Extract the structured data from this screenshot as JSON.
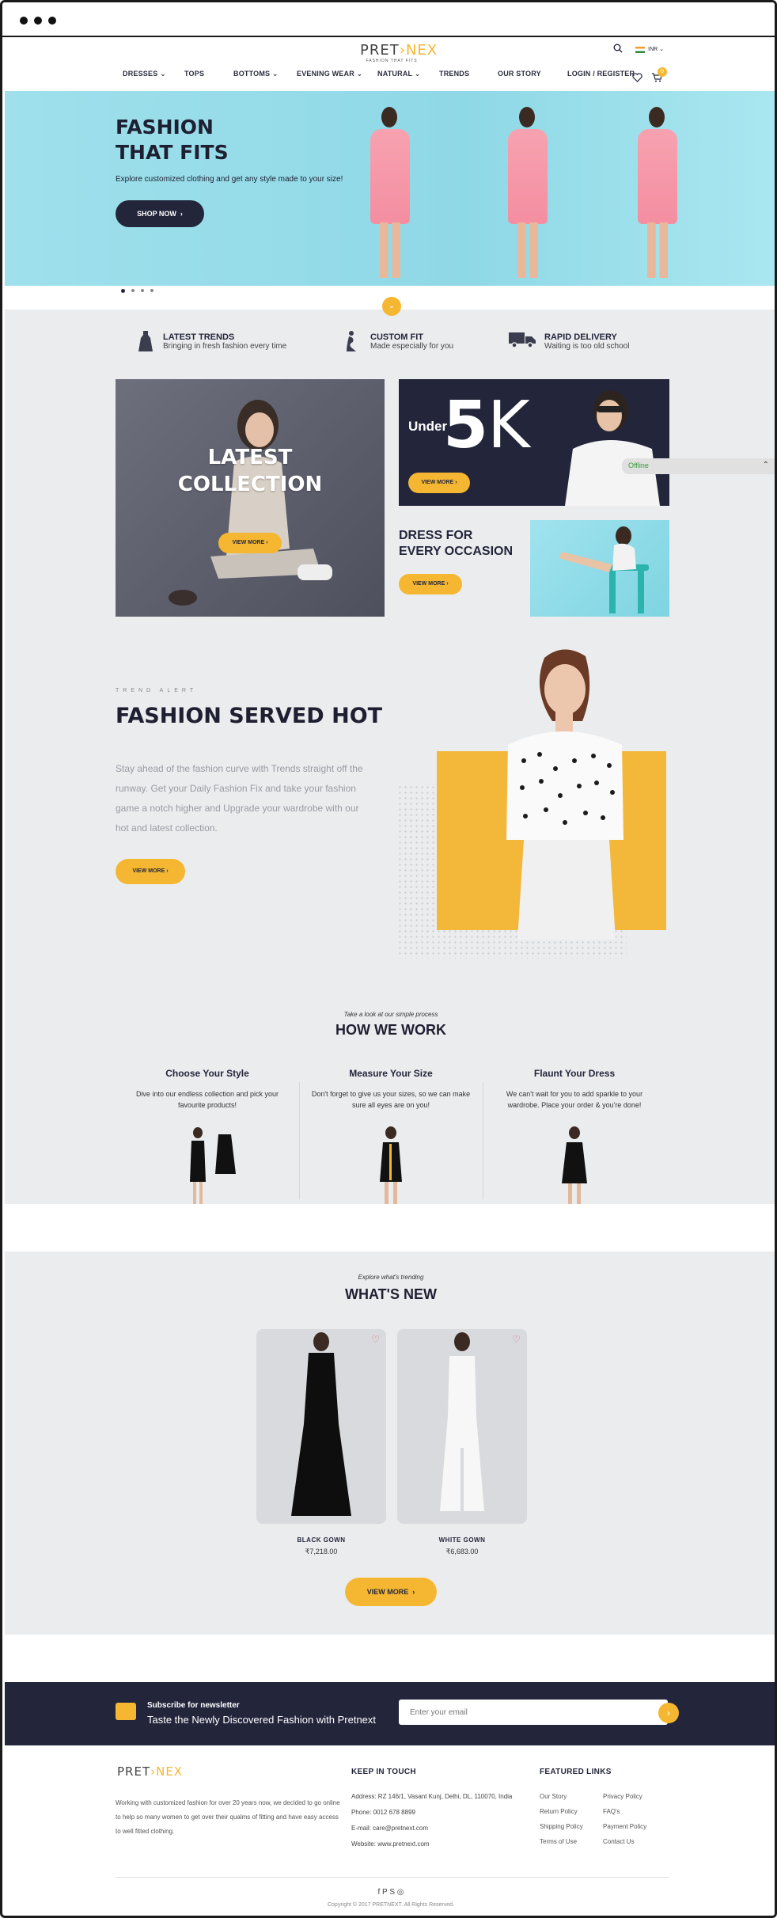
{
  "brand": {
    "name_left": "PRET",
    "name_right": "NEX",
    "tagline": "FASHION THAT FITS",
    "currency": "INR"
  },
  "nav": [
    "DRESSES",
    "TOPS",
    "BOTTOMS",
    "EVENING WEAR",
    "NATURAL",
    "TRENDS",
    "OUR STORY",
    "LOGIN / REGISTER"
  ],
  "cart_count": "0",
  "hero": {
    "title_line1": "FASHION",
    "title_line2": "THAT FITS",
    "subtitle": "Explore customized clothing and get any style made to your size!",
    "cta": "SHOP NOW"
  },
  "features": [
    {
      "title": "LATEST TRENDS",
      "sub": "Bringing in fresh fashion every time",
      "icon": "dress-icon"
    },
    {
      "title": "CUSTOM FIT",
      "sub": "Made especially for you",
      "icon": "mannequin-icon"
    },
    {
      "title": "RAPID DELIVERY",
      "sub": "Waiting is too old school",
      "icon": "truck-icon"
    }
  ],
  "tiles": {
    "latest_line1": "LATEST",
    "latest_line2": "COLLECTION",
    "latest_cta": "VIEW MORE",
    "fivek_under": "Under",
    "fivek_num": "5",
    "fivek_k": "K",
    "fivek_cta": "VIEW MORE",
    "occasion_line1": "DRESS FOR",
    "occasion_line2": "EVERY OCCASION",
    "occasion_cta": "VIEW MORE"
  },
  "chat": {
    "status": "Offline"
  },
  "trend": {
    "eyebrow": "TREND ALERT",
    "title": "FASHION SERVED HOT",
    "body": "Stay ahead of the fashion curve with Trends straight off the runway. Get your Daily Fashion Fix and take your fashion game a notch higher and Upgrade your wardrobe with our hot and latest collection.",
    "cta": "VIEW MORE"
  },
  "how": {
    "eyebrow": "Take a look at our simple process",
    "title": "HOW WE WORK",
    "steps": [
      {
        "title": "Choose Your Style",
        "text": "Dive into our endless collection and pick your favourite products!"
      },
      {
        "title": "Measure Your Size",
        "text": "Don't forget to give us your sizes, so we can make sure all eyes are on you!"
      },
      {
        "title": "Flaunt Your Dress",
        "text": "We can't wait for you to add sparkle to your wardrobe. Place your order & you're done!"
      }
    ]
  },
  "whats_new": {
    "eyebrow": "Explore what's trending",
    "title": "WHAT'S NEW",
    "products": [
      {
        "name": "BLACK GOWN",
        "price": "₹7,218.00"
      },
      {
        "name": "WHITE GOWN",
        "price": "₹6,683.00"
      }
    ],
    "cta": "VIEW MORE"
  },
  "newsletter": {
    "label": "Subscribe for newsletter",
    "headline": "Taste the Newly Discovered Fashion with Pretnext",
    "placeholder": "Enter your email"
  },
  "footer": {
    "about": "Working with customized fashion for over 20 years now, we decided to go online to help so many women to get over their qualms of fitting and have easy access to well fitted clothing.",
    "contact_title": "KEEP IN TOUCH",
    "address": "Address: RZ 146/1, Vasant Kunj, Delhi, DL, 110070, India",
    "phone": "Phone: 0012 678 8899",
    "email": "E-mail: care@pretnext.com",
    "website": "Website: www.pretnext.com",
    "links_title": "FEATURED LINKS",
    "links_col1": [
      "Our Story",
      "Return Policy",
      "Shipping Policy",
      "Terms of Use"
    ],
    "links_col2": [
      "Privacy Policy",
      "FAQ's",
      "Payment Policy",
      "Contact Us"
    ],
    "social": "f  P  S  ◎",
    "copyright": "Copyright © 2017 PRETNEXT. All Rights Reserved."
  },
  "colors": {
    "accent": "#f5b731",
    "navy": "#23263b",
    "hero_bg": "#9fe0ec",
    "grey_bg": "#ebecee"
  }
}
